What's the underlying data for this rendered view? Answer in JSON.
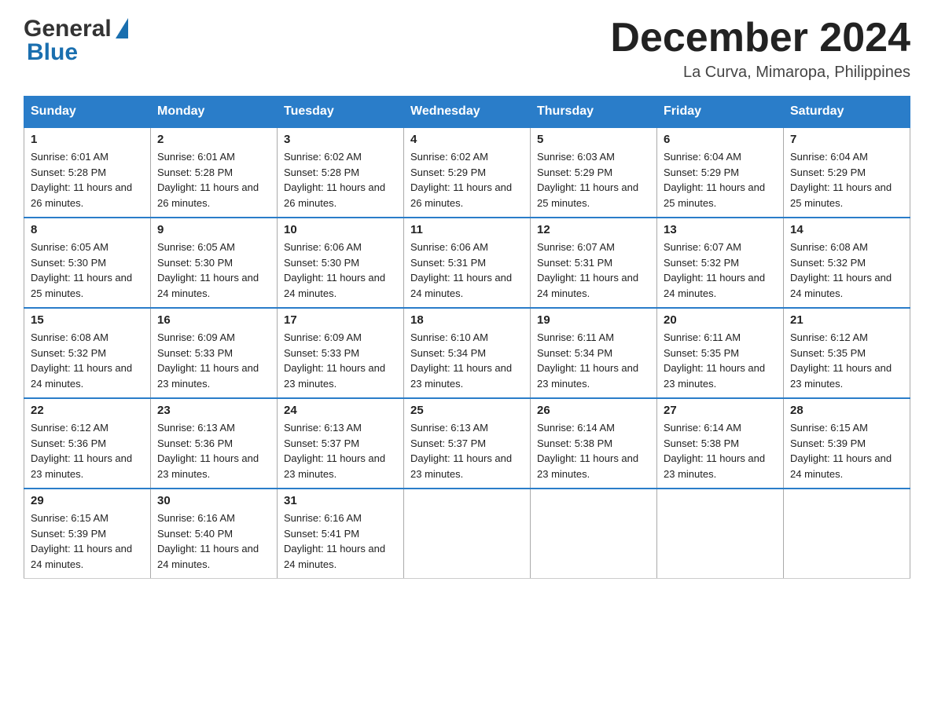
{
  "header": {
    "logo_general": "General",
    "logo_blue": "Blue",
    "month_title": "December 2024",
    "location": "La Curva, Mimaropa, Philippines"
  },
  "days_of_week": [
    "Sunday",
    "Monday",
    "Tuesday",
    "Wednesday",
    "Thursday",
    "Friday",
    "Saturday"
  ],
  "weeks": [
    [
      {
        "day": "1",
        "sunrise": "6:01 AM",
        "sunset": "5:28 PM",
        "daylight": "11 hours and 26 minutes."
      },
      {
        "day": "2",
        "sunrise": "6:01 AM",
        "sunset": "5:28 PM",
        "daylight": "11 hours and 26 minutes."
      },
      {
        "day": "3",
        "sunrise": "6:02 AM",
        "sunset": "5:28 PM",
        "daylight": "11 hours and 26 minutes."
      },
      {
        "day": "4",
        "sunrise": "6:02 AM",
        "sunset": "5:29 PM",
        "daylight": "11 hours and 26 minutes."
      },
      {
        "day": "5",
        "sunrise": "6:03 AM",
        "sunset": "5:29 PM",
        "daylight": "11 hours and 25 minutes."
      },
      {
        "day": "6",
        "sunrise": "6:04 AM",
        "sunset": "5:29 PM",
        "daylight": "11 hours and 25 minutes."
      },
      {
        "day": "7",
        "sunrise": "6:04 AM",
        "sunset": "5:29 PM",
        "daylight": "11 hours and 25 minutes."
      }
    ],
    [
      {
        "day": "8",
        "sunrise": "6:05 AM",
        "sunset": "5:30 PM",
        "daylight": "11 hours and 25 minutes."
      },
      {
        "day": "9",
        "sunrise": "6:05 AM",
        "sunset": "5:30 PM",
        "daylight": "11 hours and 24 minutes."
      },
      {
        "day": "10",
        "sunrise": "6:06 AM",
        "sunset": "5:30 PM",
        "daylight": "11 hours and 24 minutes."
      },
      {
        "day": "11",
        "sunrise": "6:06 AM",
        "sunset": "5:31 PM",
        "daylight": "11 hours and 24 minutes."
      },
      {
        "day": "12",
        "sunrise": "6:07 AM",
        "sunset": "5:31 PM",
        "daylight": "11 hours and 24 minutes."
      },
      {
        "day": "13",
        "sunrise": "6:07 AM",
        "sunset": "5:32 PM",
        "daylight": "11 hours and 24 minutes."
      },
      {
        "day": "14",
        "sunrise": "6:08 AM",
        "sunset": "5:32 PM",
        "daylight": "11 hours and 24 minutes."
      }
    ],
    [
      {
        "day": "15",
        "sunrise": "6:08 AM",
        "sunset": "5:32 PM",
        "daylight": "11 hours and 24 minutes."
      },
      {
        "day": "16",
        "sunrise": "6:09 AM",
        "sunset": "5:33 PM",
        "daylight": "11 hours and 23 minutes."
      },
      {
        "day": "17",
        "sunrise": "6:09 AM",
        "sunset": "5:33 PM",
        "daylight": "11 hours and 23 minutes."
      },
      {
        "day": "18",
        "sunrise": "6:10 AM",
        "sunset": "5:34 PM",
        "daylight": "11 hours and 23 minutes."
      },
      {
        "day": "19",
        "sunrise": "6:11 AM",
        "sunset": "5:34 PM",
        "daylight": "11 hours and 23 minutes."
      },
      {
        "day": "20",
        "sunrise": "6:11 AM",
        "sunset": "5:35 PM",
        "daylight": "11 hours and 23 minutes."
      },
      {
        "day": "21",
        "sunrise": "6:12 AM",
        "sunset": "5:35 PM",
        "daylight": "11 hours and 23 minutes."
      }
    ],
    [
      {
        "day": "22",
        "sunrise": "6:12 AM",
        "sunset": "5:36 PM",
        "daylight": "11 hours and 23 minutes."
      },
      {
        "day": "23",
        "sunrise": "6:13 AM",
        "sunset": "5:36 PM",
        "daylight": "11 hours and 23 minutes."
      },
      {
        "day": "24",
        "sunrise": "6:13 AM",
        "sunset": "5:37 PM",
        "daylight": "11 hours and 23 minutes."
      },
      {
        "day": "25",
        "sunrise": "6:13 AM",
        "sunset": "5:37 PM",
        "daylight": "11 hours and 23 minutes."
      },
      {
        "day": "26",
        "sunrise": "6:14 AM",
        "sunset": "5:38 PM",
        "daylight": "11 hours and 23 minutes."
      },
      {
        "day": "27",
        "sunrise": "6:14 AM",
        "sunset": "5:38 PM",
        "daylight": "11 hours and 23 minutes."
      },
      {
        "day": "28",
        "sunrise": "6:15 AM",
        "sunset": "5:39 PM",
        "daylight": "11 hours and 24 minutes."
      }
    ],
    [
      {
        "day": "29",
        "sunrise": "6:15 AM",
        "sunset": "5:39 PM",
        "daylight": "11 hours and 24 minutes."
      },
      {
        "day": "30",
        "sunrise": "6:16 AM",
        "sunset": "5:40 PM",
        "daylight": "11 hours and 24 minutes."
      },
      {
        "day": "31",
        "sunrise": "6:16 AM",
        "sunset": "5:41 PM",
        "daylight": "11 hours and 24 minutes."
      },
      null,
      null,
      null,
      null
    ]
  ],
  "labels": {
    "sunrise_prefix": "Sunrise: ",
    "sunset_prefix": "Sunset: ",
    "daylight_prefix": "Daylight: "
  }
}
